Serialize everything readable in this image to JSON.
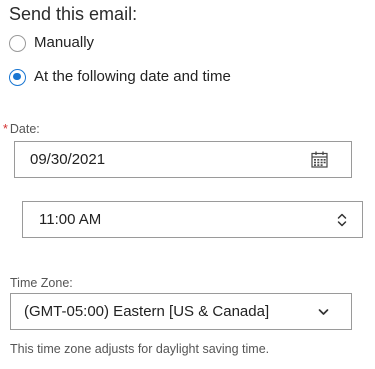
{
  "send_email": {
    "heading": "Send this email:",
    "options": [
      {
        "label": "Manually",
        "selected": false
      },
      {
        "label": "At the following date and time",
        "selected": true
      }
    ]
  },
  "date_field": {
    "required_marker": "*",
    "label": "Date:",
    "value": "09/30/2021",
    "icon": "calendar-icon"
  },
  "time_field": {
    "value": "11:00 AM",
    "icon": "updown-chevron-icon"
  },
  "timezone_field": {
    "label": "Time Zone:",
    "value": "(GMT-05:00) Eastern [US & Canada]",
    "icon": "chevron-down-icon",
    "note": "This time zone adjusts for daylight saving time."
  },
  "colors": {
    "accent": "#1976d2",
    "required": "#d32f2f",
    "border": "#9a9a9a",
    "text": "#222222",
    "muted_text": "#555555"
  }
}
